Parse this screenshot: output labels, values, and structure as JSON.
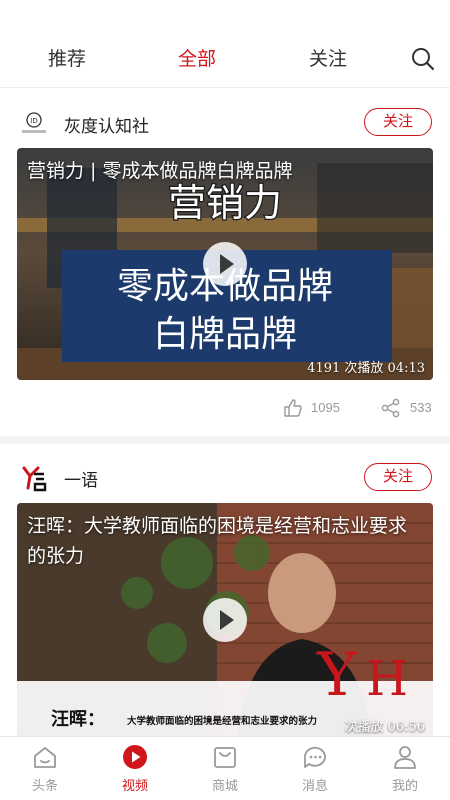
{
  "top_tabs": [
    {
      "label": "推荐",
      "active": false
    },
    {
      "label": "全部",
      "active": true
    },
    {
      "label": "关注",
      "active": false
    }
  ],
  "colors": {
    "accent": "#d0161b",
    "muted": "#999999"
  },
  "posts": [
    {
      "author": "灰度认知社",
      "follow_label": "关注",
      "video_title": "营销力 | 零成本做品牌白牌品牌",
      "thumb_headline": "营销力",
      "thumb_line1": "零成本做品牌",
      "thumb_line2": "白牌品牌",
      "meta": "4191 次播放  04:13",
      "likes": "1095",
      "shares": "533"
    },
    {
      "author": "一语",
      "follow_label": "关注",
      "video_title": "汪晖：大学教师面临的困境是经营和志业要求的张力",
      "thumb_caption_name": "汪晖：",
      "thumb_caption_text": "大学教师面临的困境是经营和志业要求的张力",
      "meta": "次播放  06:56"
    }
  ],
  "bottom_nav": [
    {
      "label": "头条",
      "icon": "home-icon",
      "active": false
    },
    {
      "label": "视频",
      "icon": "video-play-icon",
      "active": true
    },
    {
      "label": "商城",
      "icon": "shopping-bag-icon",
      "active": false
    },
    {
      "label": "消息",
      "icon": "message-icon",
      "active": false
    },
    {
      "label": "我的",
      "icon": "profile-icon",
      "active": false
    }
  ]
}
